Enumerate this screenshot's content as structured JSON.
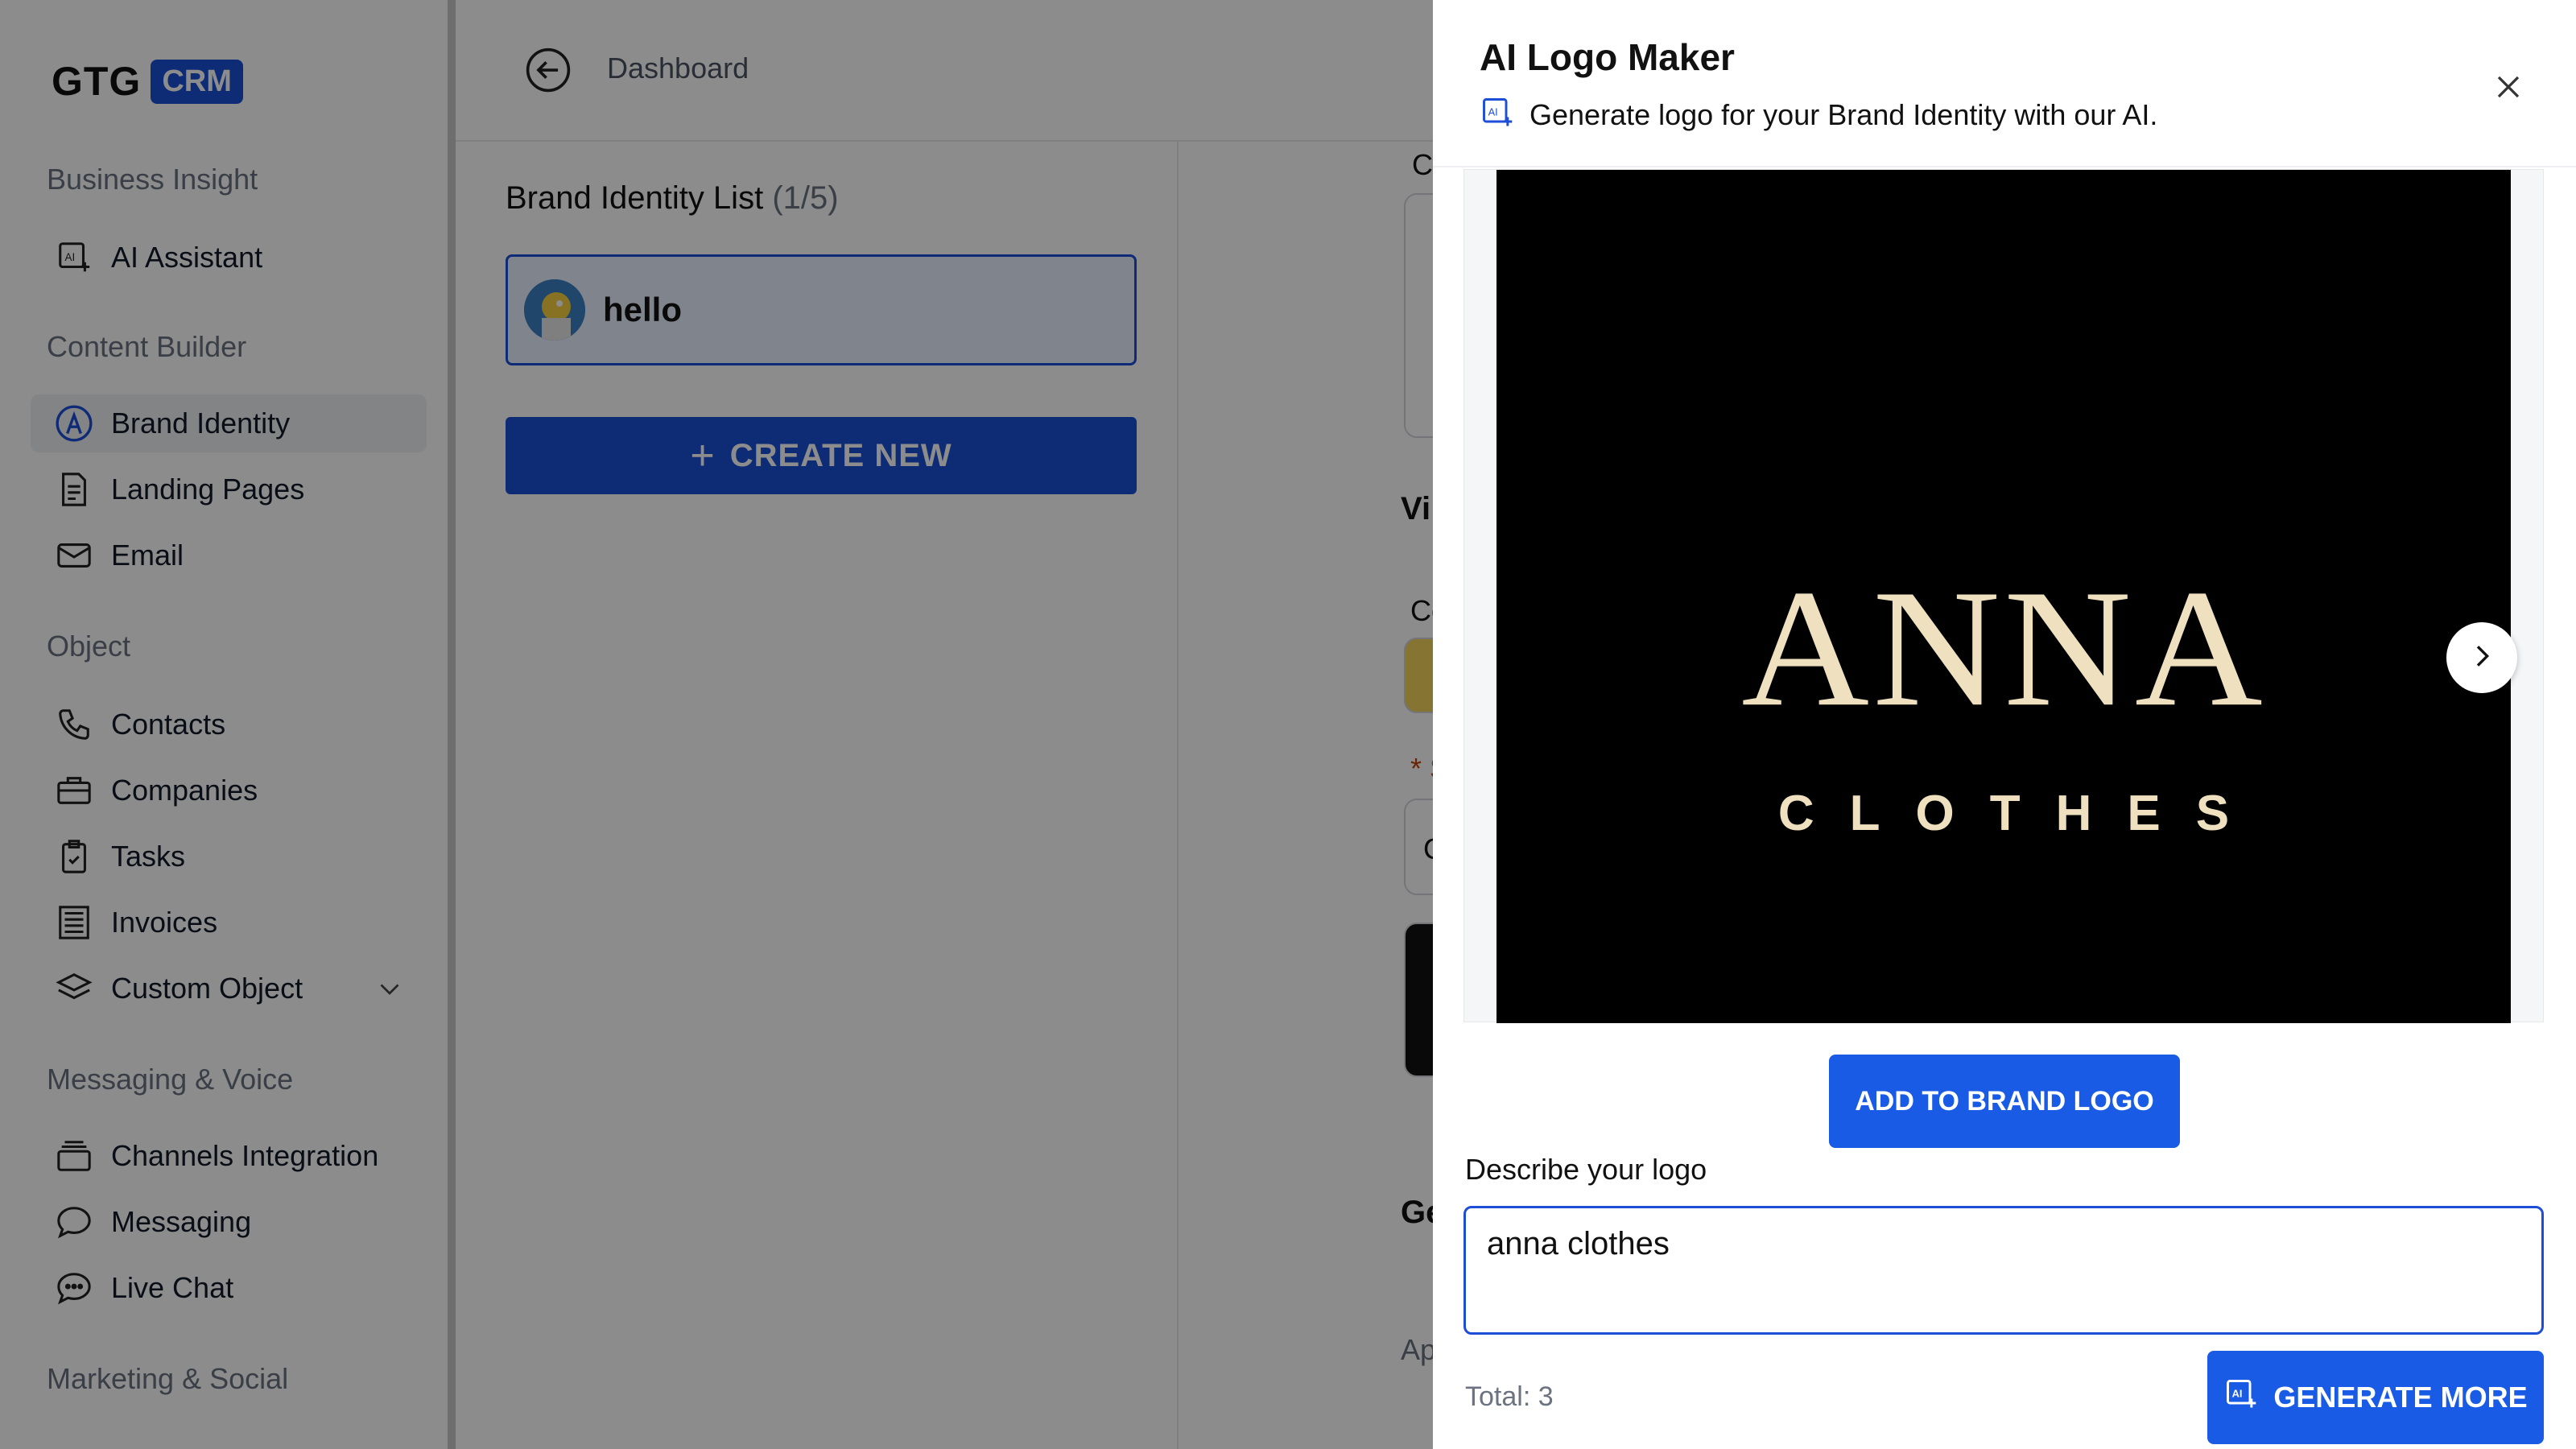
{
  "app": {
    "logo_text": "GTG",
    "logo_badge": "CRM"
  },
  "sidebar": {
    "sections": [
      {
        "title": "Business Insight"
      },
      {
        "title": "Content Builder"
      },
      {
        "title": "Object"
      },
      {
        "title": "Messaging & Voice"
      },
      {
        "title": "Marketing & Social"
      }
    ],
    "items": [
      {
        "label": "AI Assistant",
        "icon": "ai-assistant-icon"
      },
      {
        "label": "Brand Identity",
        "icon": "brand-identity-icon",
        "active": true
      },
      {
        "label": "Landing Pages",
        "icon": "document-icon"
      },
      {
        "label": "Email",
        "icon": "mail-icon"
      },
      {
        "label": "Contacts",
        "icon": "phone-icon"
      },
      {
        "label": "Companies",
        "icon": "briefcase-icon"
      },
      {
        "label": "Tasks",
        "icon": "clipboard-check-icon"
      },
      {
        "label": "Invoices",
        "icon": "invoice-icon"
      },
      {
        "label": "Custom Object",
        "icon": "layers-icon"
      },
      {
        "label": "Channels Integration",
        "icon": "stack-icon"
      },
      {
        "label": "Messaging",
        "icon": "chat-bubble-icon"
      },
      {
        "label": "Live Chat",
        "icon": "live-chat-icon"
      }
    ]
  },
  "topbar": {
    "breadcrumb": "Dashboard"
  },
  "brand_list": {
    "title": "Brand Identity List",
    "count": "(1/5)",
    "items": [
      {
        "name": "hello"
      }
    ],
    "create_label": "CREATE NEW"
  },
  "background_peek": {
    "labels": [
      "Co",
      "Vi",
      "Co",
      "* S",
      "C",
      "Ge",
      "Ap"
    ]
  },
  "drawer": {
    "title": "AI Logo Maker",
    "subtitle": "Generate logo for your Brand Identity with our AI.",
    "preview": {
      "logo_main": "ANNA",
      "logo_sub": "CLOTHES"
    },
    "add_button": "ADD TO BRAND LOGO",
    "describe_label": "Describe your logo",
    "describe_value": "anna clothes",
    "total_text": "Total: 3",
    "generate_button": "GENERATE MORE"
  },
  "colors": {
    "primary": "#1a5be6",
    "active_border": "#1d4ed8",
    "overlay": "rgba(0,0,0,0.45)"
  }
}
